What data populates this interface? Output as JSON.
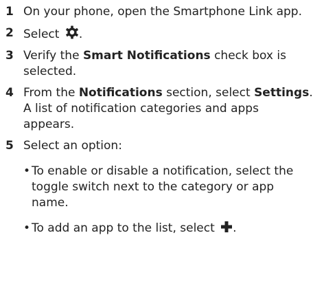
{
  "steps": [
    {
      "number": "1",
      "text": "On your phone, open the Smartphone Link app."
    },
    {
      "number": "2",
      "text": "Select",
      "suffix": ".",
      "icon": "gear-icon"
    },
    {
      "number": "3",
      "pre": "Verify the ",
      "bold": "Smart Notifications",
      "post": " check box is selected."
    },
    {
      "number": "4",
      "pre": "From the ",
      "bold": "Notifications",
      "mid": " section, select ",
      "bold2": "Settings",
      "post": ".",
      "note": "A list of notification categories and apps appears."
    },
    {
      "number": "5",
      "text": "Select an option:",
      "bullets": [
        {
          "bullet": "•",
          "text": "To enable or disable a notification, select the toggle switch next to the category or app name."
        },
        {
          "bullet": "•",
          "text": "To add an app to the list, select",
          "suffix": ".",
          "icon": "plus-icon"
        }
      ]
    }
  ]
}
